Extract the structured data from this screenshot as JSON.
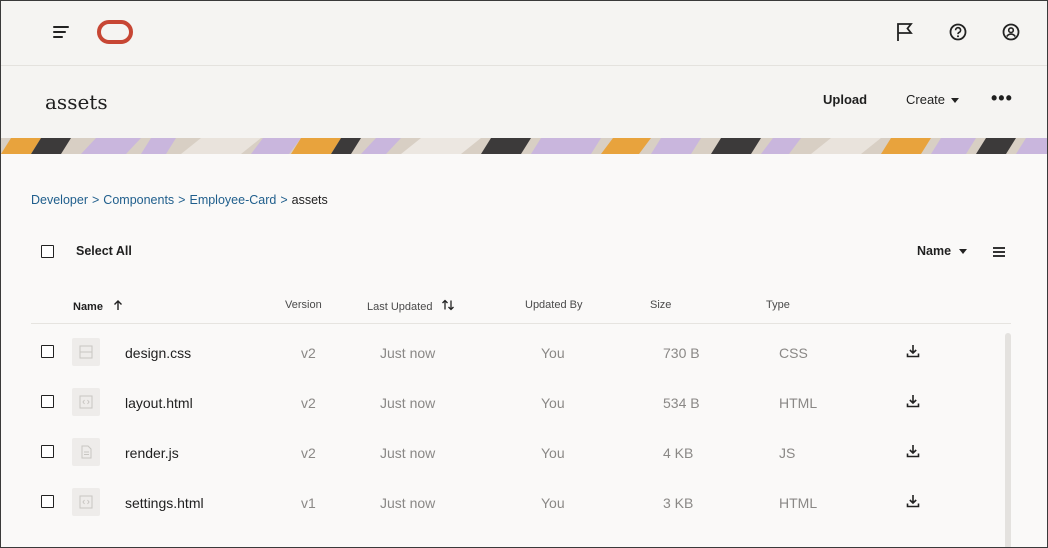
{
  "header": {
    "menu_icon": "hamburger-menu-icon",
    "logo": "oracle-logo",
    "icons": [
      "flag-icon",
      "help-icon",
      "user-profile-icon"
    ]
  },
  "title_bar": {
    "title": "assets",
    "upload_label": "Upload",
    "create_label": "Create",
    "more_label": "•••"
  },
  "breadcrumb": {
    "items": [
      "Developer",
      "Components",
      "Employee-Card"
    ],
    "separator": ">",
    "current": "assets"
  },
  "toolbar": {
    "select_all_label": "Select All",
    "sort_label": "Name",
    "view_icon": "list-view-icon"
  },
  "columns": {
    "name": "Name",
    "version": "Version",
    "last_updated": "Last Updated",
    "updated_by": "Updated By",
    "size": "Size",
    "type": "Type"
  },
  "files": [
    {
      "name": "design.css",
      "version": "v2",
      "last_updated": "Just now",
      "updated_by": "You",
      "size": "730 B",
      "type": "CSS",
      "icon": "css-file-icon"
    },
    {
      "name": "layout.html",
      "version": "v2",
      "last_updated": "Just now",
      "updated_by": "You",
      "size": "534 B",
      "type": "HTML",
      "icon": "code-file-icon"
    },
    {
      "name": "render.js",
      "version": "v2",
      "last_updated": "Just now",
      "updated_by": "You",
      "size": "4 KB",
      "type": "JS",
      "icon": "document-file-icon"
    },
    {
      "name": "settings.html",
      "version": "v1",
      "last_updated": "Just now",
      "updated_by": "You",
      "size": "3 KB",
      "type": "HTML",
      "icon": "code-file-icon"
    }
  ],
  "colors": {
    "brand_red": "#c74634",
    "link_blue": "#1f5e8c",
    "banner_orange": "#e8a33d",
    "banner_purple": "#c9b6dd",
    "banner_dark": "#3c3a3a"
  }
}
